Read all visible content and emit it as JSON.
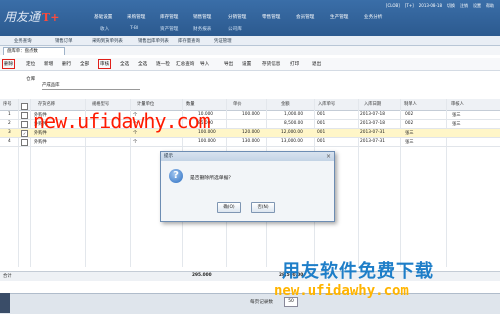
{
  "app": {
    "logo": "用友通",
    "logo_mark": "T+",
    "topright": [
      "[CLOB]",
      "[T+]",
      "2013-08-18",
      "切换",
      "注销",
      "设置",
      "帮助"
    ]
  },
  "menu_row1": [
    "基础设置",
    "采购管理",
    "库存管理",
    "销售管理",
    "分销管理",
    "零售管理",
    "会员管理",
    "生产管理",
    "业务分析"
  ],
  "menu_row2": [
    "收入",
    "T-BI",
    "资产管理",
    "财务报表",
    "公司库"
  ],
  "open_tabs": [
    "业务查询",
    "销售订单",
    "采购到货单列表",
    "销售出库单列表",
    "库存量查询",
    "凭证管理"
  ],
  "doc_tab": "盘库单：盘点数",
  "toolbar": [
    "删除",
    "定位",
    "新增",
    "删行",
    "全部",
    "审核",
    "全选",
    "全选",
    "逐一检",
    "汇总查询",
    "导入",
    "导出",
    "设置",
    "存货信息",
    "打印",
    "退出"
  ],
  "highlighted_toolbar": [
    "删除",
    "审核"
  ],
  "warehouse_label": "仓库",
  "warehouse_value": "产成品库",
  "columns": [
    "序号",
    "",
    "存货名称",
    "规格型号",
    "计量单位",
    "数量",
    "单价",
    "金额",
    "入库单号",
    "入库日期",
    "制单人",
    "审核人"
  ],
  "rows": [
    {
      "no": "1",
      "checked": false,
      "name": "外购件",
      "spec": "",
      "unit": "个",
      "qty": "10.000",
      "price": "100.000",
      "amount": "1,000.00",
      "code": "001",
      "date": "2013-07-18",
      "maker": "002",
      "auditor": "张三",
      "selected": false
    },
    {
      "no": "2",
      "checked": false,
      "name": "外购件",
      "spec": "",
      "unit": "个",
      "qty": "85.000",
      "price": "",
      "amount": "8,500.00",
      "code": "001",
      "date": "2013-07-18",
      "maker": "002",
      "auditor": "张三",
      "selected": false
    },
    {
      "no": "3",
      "checked": true,
      "name": "外购件",
      "spec": "",
      "unit": "个",
      "qty": "100.000",
      "price": "120.000",
      "amount": "12,000.00",
      "code": "001",
      "date": "2013-07-31",
      "maker": "张三",
      "auditor": "",
      "selected": true
    },
    {
      "no": "4",
      "checked": false,
      "name": "外购件",
      "spec": "",
      "unit": "个",
      "qty": "100.000",
      "price": "130.000",
      "amount": "13,000.00",
      "code": "001",
      "date": "2013-07-31",
      "maker": "张三",
      "auditor": "",
      "selected": false
    }
  ],
  "totals": {
    "label": "合计",
    "qty": "295.000",
    "amount": "28,500.00"
  },
  "watermark_url": "new.ufidawhy.com",
  "dialog": {
    "title": "提示",
    "message": "是否删除所选单据？",
    "ok": "确(O)",
    "cancel": "否(N)"
  },
  "promo_text": "用友软件免费下载",
  "promo_url": "new.ufidawhy.com",
  "pager": {
    "label": "每页记录数",
    "value": "50"
  },
  "colors": {
    "header_blue": "#2c5a8f",
    "highlight_red": "#e0201a",
    "selected_row": "#fff6c8",
    "promo_blue": "#1e7ec8",
    "promo_orange": "#ffb400"
  }
}
